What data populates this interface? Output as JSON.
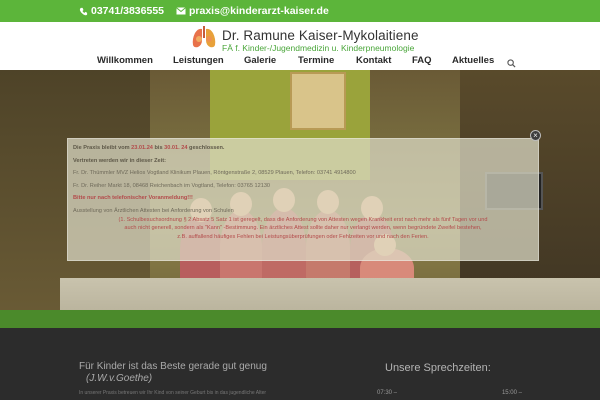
{
  "topbar": {
    "phone": "03741/3836555",
    "email": "praxis@kinderarzt-kaiser.de"
  },
  "header": {
    "logo_name": "Dr. Ramune Kaiser-Mykolaitiene",
    "logo_sub": "FÄ f. Kinder-/Jugendmedizin u. Kinderpneumologie",
    "logo_icon": "lungs-icon"
  },
  "nav": {
    "items": [
      "Willkommen",
      "Leistungen",
      "Galerie",
      "Termine",
      "Kontakt",
      "FAQ",
      "Aktuelles"
    ],
    "search_icon": "search-icon"
  },
  "notice": {
    "line1_pre": "Die Praxis bleibt vom ",
    "line1_date1": "23.01.24",
    "line1_mid": " bis ",
    "line1_date2": "30.01. 24",
    "line1_post": " geschlossen.",
    "line2": "Vertreten werden wir in dieser Zeit:",
    "line3": "Fr. Dr. Thümmler MVZ Helios Vogtland Klinikum Plauen, Röntgenstraße 2, 08529 Plauen, Telefon: 03741 4914800",
    "line4": "Fr. Dr. Reiher Markt 18, 08468 Reichenbach im Vogtland, Telefon: 03765 12130",
    "line5": "Bitte nur nach telefonischer Voranmeldung!!!",
    "line6": "Ausstellung von Ärztlichen Attesten bei Anforderung von Schulen",
    "line7": "(1. Schulbesuchsordnung § 2 Absatz 5 Satz 1 ist geregelt, dass die Anforderung von Attesten wegen Krankheit erst nach mehr als fünf Tagen vor und",
    "line8": "auch nicht generell, sondern als \"Kann\" -Bestimmung. Ein ärztliches Attest sollte daher nur verlangt werden, wenn begründete Zweifel bestehen,",
    "line9": "z.B. auffallend häufiges Fehlen bei Leistungsüberprüfungen oder Fehlzeiten vor und nach den Ferien."
  },
  "lower": {
    "quote": "Für Kinder ist das Beste gerade gut genug",
    "author": "(J.W.v.Goethe)",
    "intro": "In unserer Praxis betreuen wir Ihr Kind von seiner Geburt bis in das jugendliche Alter",
    "hours_title": "Unsere Sprechzeiten:",
    "hours_col1": "07:30 –",
    "hours_col2": "15:00 –"
  },
  "colors": {
    "accent_green": "#5cb53a",
    "notice_red": "#b34b4b"
  }
}
